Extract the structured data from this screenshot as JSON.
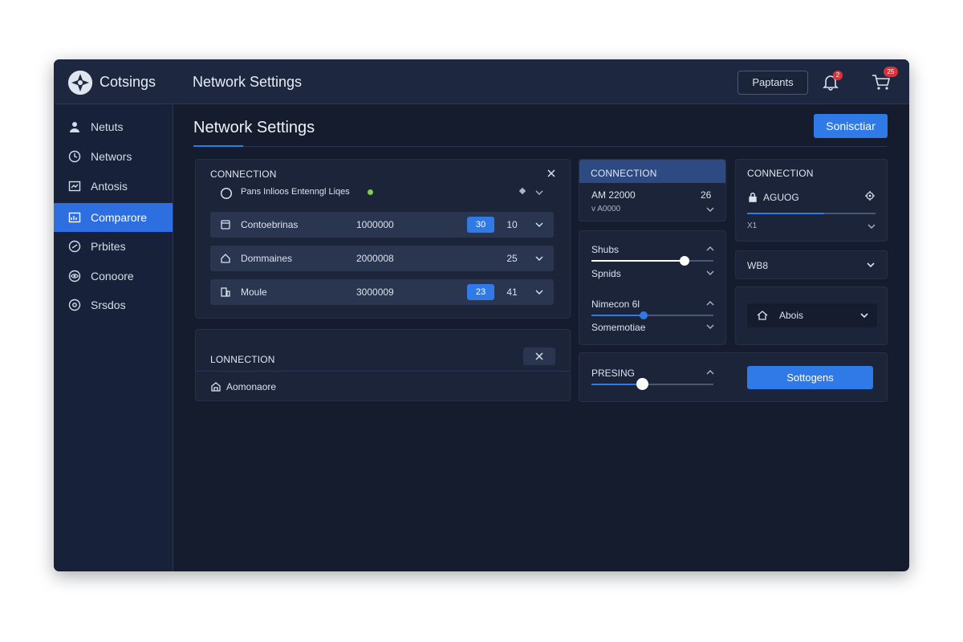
{
  "app": {
    "title": "Cotsings",
    "bar_title": "Network Settings"
  },
  "topbar": {
    "button_label": "Paptants",
    "bell_badge": "2",
    "cart_badge": "25"
  },
  "sidebar": {
    "items": [
      {
        "label": "Netuts",
        "icon": "user-icon"
      },
      {
        "label": "Networs",
        "icon": "clock-icon"
      },
      {
        "label": "Antosis",
        "icon": "chart-icon"
      },
      {
        "label": "Comparore",
        "icon": "chart-icon",
        "active": true
      },
      {
        "label": "Prbites",
        "icon": "link-icon"
      },
      {
        "label": "Conoore",
        "icon": "eye-icon"
      },
      {
        "label": "Srsdos",
        "icon": "settings-icon"
      }
    ]
  },
  "main": {
    "title": "Network Settings",
    "primary_button": "Sonisctiar"
  },
  "left_card": {
    "label": "CONNECTION",
    "header_row": "Pans Inlioos Entenngl Liqes",
    "rows": [
      {
        "name": "Contoebrinas",
        "value": "1000000",
        "pill": "30",
        "num": "10"
      },
      {
        "name": "Dommaines",
        "value": "2000008",
        "pill": "",
        "num": "25"
      },
      {
        "name": "Moule",
        "value": "3000009",
        "pill": "23",
        "num": "41"
      }
    ]
  },
  "left_card2": {
    "label": "LONNECTION",
    "item": "Aomonaore"
  },
  "mid_card": {
    "label": "CONNECTION",
    "value": "AM 22000",
    "right": "26",
    "sub": "v A0000"
  },
  "mid_card2": {
    "item1_label": "Shubs",
    "item1_sub": "Spnids",
    "item1_value": 0.76,
    "item2_label": "Nimecon 6l",
    "item2_sub": "Somemotiae",
    "item2_value": 0.43
  },
  "mid_card3": {
    "label": "PRESING",
    "value": 0.42
  },
  "right_card": {
    "label": "CONNECTION",
    "item": "AGUOG",
    "sub": "X1",
    "progress": 0.6
  },
  "right_card2": {
    "label": "WB8"
  },
  "right_card3": {
    "label": "Abois"
  },
  "right_button": "Sottogens",
  "colors": {
    "accent": "#2f7ae6",
    "window_bg": "#141c2e",
    "card_bg": "#1b2439",
    "badge": "#d8323a"
  }
}
